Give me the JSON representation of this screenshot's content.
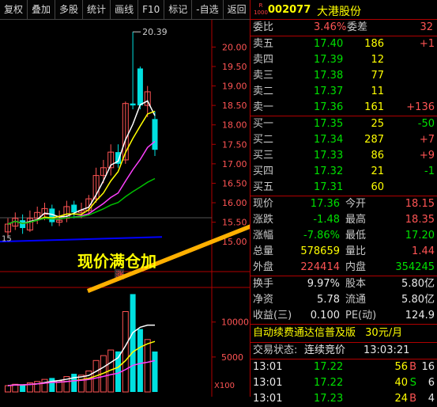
{
  "toolbar": {
    "buttons": [
      "复权",
      "叠加",
      "多股",
      "统计",
      "画线",
      "F10",
      "标记",
      "-自选",
      "返回"
    ]
  },
  "chart": {
    "price_axis": [
      "20.00",
      "19.50",
      "19.00",
      "18.50",
      "18.00",
      "17.50",
      "17.00",
      "16.50",
      "16.00",
      "15.50",
      "15.00"
    ],
    "high_label": "20.39",
    "low_label": "15",
    "zhang_mark": "涨",
    "volume_axis": [
      "10000",
      "5000"
    ],
    "volume_unit": "X100",
    "annotation": "现价满仓加"
  },
  "stock": {
    "badge_top": "R",
    "badge_bottom": "1000",
    "code": "002077",
    "name": "大港股份"
  },
  "weibi": {
    "label": "委比",
    "value": "3.46%",
    "label2": "委差",
    "value2": "32"
  },
  "sells": [
    {
      "label": "卖五",
      "price": "17.40",
      "vol": "186",
      "chg": "+1"
    },
    {
      "label": "卖四",
      "price": "17.39",
      "vol": "12",
      "chg": ""
    },
    {
      "label": "卖三",
      "price": "17.38",
      "vol": "77",
      "chg": ""
    },
    {
      "label": "卖二",
      "price": "17.37",
      "vol": "11",
      "chg": ""
    },
    {
      "label": "卖一",
      "price": "17.36",
      "vol": "161",
      "chg": "+136"
    }
  ],
  "buys": [
    {
      "label": "买一",
      "price": "17.35",
      "vol": "25",
      "chg": "-50"
    },
    {
      "label": "买二",
      "price": "17.34",
      "vol": "287",
      "chg": "+7"
    },
    {
      "label": "买三",
      "price": "17.33",
      "vol": "86",
      "chg": "+9"
    },
    {
      "label": "买四",
      "price": "17.32",
      "vol": "21",
      "chg": "-1"
    },
    {
      "label": "买五",
      "price": "17.31",
      "vol": "60",
      "chg": ""
    }
  ],
  "quote": [
    {
      "l1": "现价",
      "v1": "17.36",
      "l2": "今开",
      "v2": "18.15"
    },
    {
      "l1": "涨跌",
      "v1": "-1.48",
      "l2": "最高",
      "v2": "18.35"
    },
    {
      "l1": "涨幅",
      "v1": "-7.86%",
      "l2": "最低",
      "v2": "17.20"
    },
    {
      "l1": "总量",
      "v1": "578659",
      "l2": "量比",
      "v2": "1.44"
    },
    {
      "l1": "外盘",
      "v1": "224414",
      "l2": "内盘",
      "v2": "354245"
    }
  ],
  "fundamentals": [
    {
      "l1": "换手",
      "v1": "9.97%",
      "l2": "股本",
      "v2": "5.80亿"
    },
    {
      "l1": "净资",
      "v1": "5.78",
      "l2": "流通",
      "v2": "5.80亿"
    },
    {
      "l1": "收益(三)",
      "v1": "0.100",
      "l2": "PE(动)",
      "v2": "124.9"
    }
  ],
  "ad": {
    "text": "自动续费通达信普及版",
    "price": "30元/月"
  },
  "trade_status": {
    "label": "交易状态:",
    "value": "连续竞价",
    "time": "13:03:21"
  },
  "ticks": [
    {
      "time": "13:01",
      "price": "17.22",
      "vol": "56",
      "side": "B",
      "n": "16"
    },
    {
      "time": "13:01",
      "price": "17.22",
      "vol": "40",
      "side": "S",
      "n": "6"
    },
    {
      "time": "13:01",
      "price": "17.23",
      "vol": "24",
      "side": "B",
      "n": "4"
    }
  ],
  "colors": {
    "up": "#ff5454",
    "down": "#00e0e0",
    "ma1": "#ffffff",
    "ma2": "#ffff00",
    "ma3": "#ff40ff",
    "ma4": "#00c000",
    "ma5": "#0000ff"
  },
  "chart_data": {
    "type": "candlestick",
    "candles": [
      {
        "o": 15.25,
        "c": 15.45,
        "h": 15.6,
        "l": 15.1
      },
      {
        "o": 15.4,
        "c": 15.6,
        "h": 15.75,
        "l": 15.3
      },
      {
        "o": 15.55,
        "c": 15.35,
        "h": 15.7,
        "l": 15.2
      },
      {
        "o": 15.3,
        "c": 15.6,
        "h": 15.8,
        "l": 15.25
      },
      {
        "o": 15.6,
        "c": 15.75,
        "h": 15.9,
        "l": 15.45
      },
      {
        "o": 15.7,
        "c": 15.85,
        "h": 16.0,
        "l": 15.55
      },
      {
        "o": 15.85,
        "c": 15.5,
        "h": 15.95,
        "l": 15.4
      },
      {
        "o": 15.5,
        "c": 15.55,
        "h": 15.8,
        "l": 15.4
      },
      {
        "o": 15.6,
        "c": 15.9,
        "h": 16.05,
        "l": 15.5
      },
      {
        "o": 15.95,
        "c": 15.75,
        "h": 16.05,
        "l": 15.6
      },
      {
        "o": 15.75,
        "c": 15.8,
        "h": 16.0,
        "l": 15.6
      },
      {
        "o": 15.8,
        "c": 16.1,
        "h": 16.2,
        "l": 15.7
      },
      {
        "o": 16.1,
        "c": 16.7,
        "h": 16.9,
        "l": 16.0
      },
      {
        "o": 16.7,
        "c": 16.9,
        "h": 17.1,
        "l": 16.5
      },
      {
        "o": 16.9,
        "c": 17.3,
        "h": 17.5,
        "l": 16.7
      },
      {
        "o": 17.3,
        "c": 17.0,
        "h": 17.5,
        "l": 16.9
      },
      {
        "o": 17.1,
        "c": 18.55,
        "h": 18.6,
        "l": 17.0
      },
      {
        "o": 18.55,
        "c": 18.5,
        "h": 20.39,
        "l": 18.4
      },
      {
        "o": 19.45,
        "c": 18.5,
        "h": 19.5,
        "l": 18.4
      },
      {
        "o": 18.5,
        "c": 18.85,
        "h": 19.0,
        "l": 18.2
      },
      {
        "o": 18.15,
        "c": 17.36,
        "h": 18.35,
        "l": 17.2
      }
    ],
    "volumes": [
      900,
      1100,
      1000,
      1300,
      1500,
      1800,
      2000,
      1600,
      2200,
      2600,
      2400,
      3000,
      4500,
      5200,
      6000,
      5800,
      11500,
      14000,
      9000,
      7500,
      5786
    ],
    "ylim": [
      14.8,
      20.7
    ],
    "vol_max": 14500
  }
}
